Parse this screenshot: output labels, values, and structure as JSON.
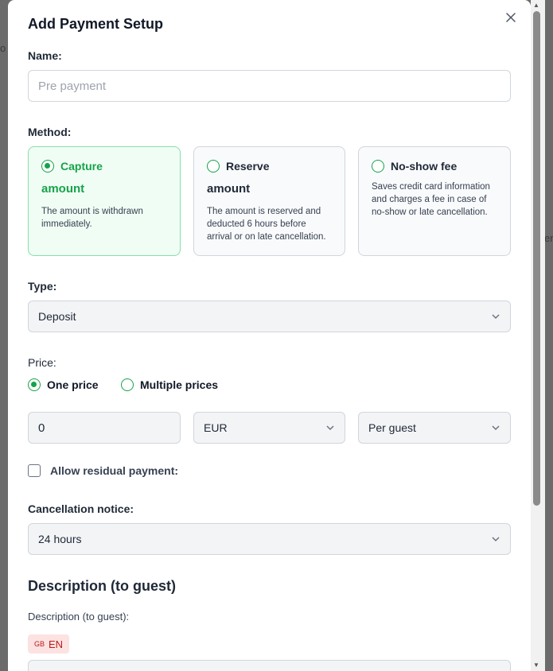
{
  "backdrop": {
    "left_text": "o",
    "right_text": "en"
  },
  "modal": {
    "title": "Add Payment Setup",
    "close_label": "×"
  },
  "name": {
    "label": "Name:",
    "placeholder": "Pre payment"
  },
  "method": {
    "label": "Method:",
    "options": [
      {
        "title": "Capture",
        "subtitle": "amount",
        "description": "The amount is withdrawn immediately.",
        "selected": true
      },
      {
        "title": "Reserve",
        "subtitle": "amount",
        "description": "The amount is reserved and deducted 6 hours before arrival or on late cancellation.",
        "selected": false
      },
      {
        "title": "No-show fee",
        "subtitle": "",
        "description": "Saves credit card information and charges a fee in case of no-show or late cancellation.",
        "selected": false
      }
    ]
  },
  "type": {
    "label": "Type:",
    "value": "Deposit"
  },
  "price": {
    "label": "Price:",
    "one_price": "One price",
    "multiple_prices": "Multiple prices",
    "amount": "0",
    "currency": "EUR",
    "per": "Per guest"
  },
  "residual": {
    "label": "Allow residual payment:",
    "checked": false
  },
  "cancellation": {
    "label": "Cancellation notice:",
    "value": "24 hours"
  },
  "description": {
    "section_title": "Description (to guest)",
    "label": "Description (to guest):",
    "lang_flag": "GB",
    "lang_code": "EN"
  },
  "colors": {
    "accent": "#16a34a",
    "active_bg": "#f0fdf4",
    "badge_bg": "#fde2e2",
    "badge_text": "#b91c1c"
  }
}
